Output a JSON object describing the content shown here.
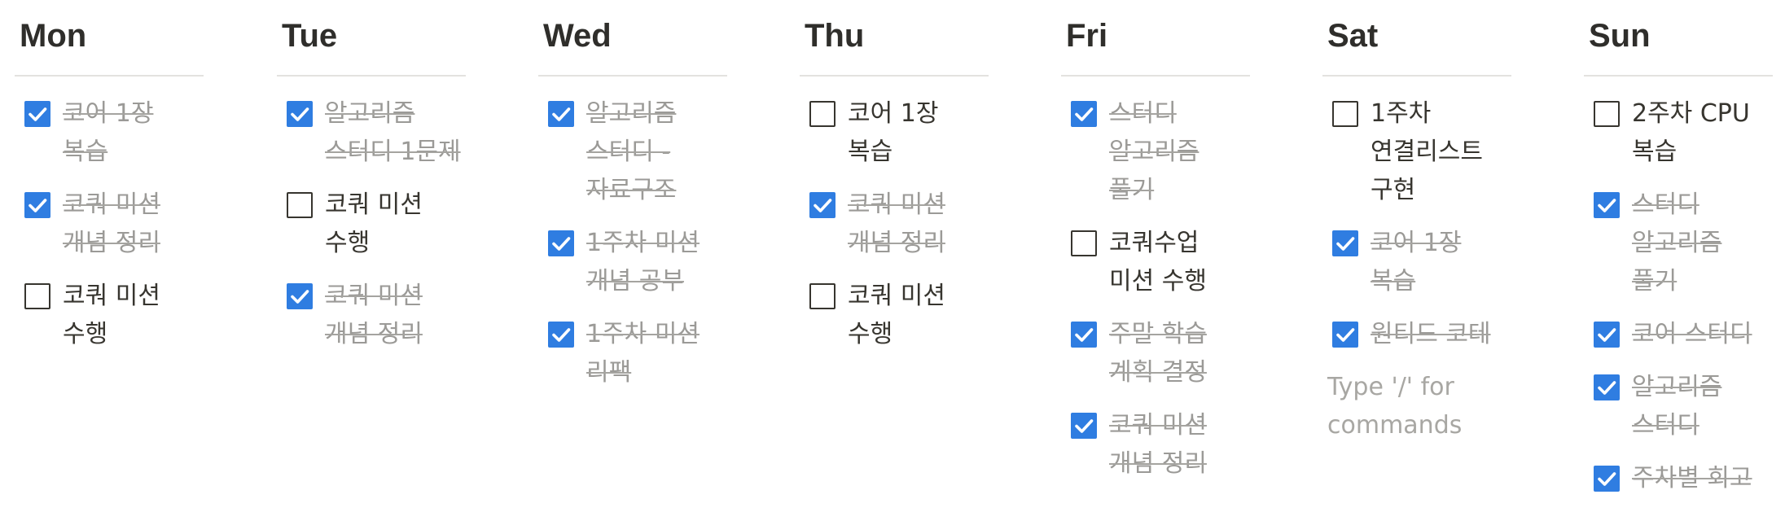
{
  "board": {
    "placeholder": "Type '/' for commands",
    "columns": [
      {
        "day": "Mon",
        "items": [
          {
            "text": "코어 1장 복습",
            "checked": true
          },
          {
            "text": "코쿼 미션 개념 정리",
            "checked": true
          },
          {
            "text": "코쿼 미션 수행",
            "checked": false
          }
        ]
      },
      {
        "day": "Tue",
        "items": [
          {
            "text": "알고리즘 스터디 1문제",
            "checked": true
          },
          {
            "text": "코쿼 미션 수행",
            "checked": false
          },
          {
            "text": "코쿼 미션 개념 정리",
            "checked": true
          }
        ]
      },
      {
        "day": "Wed",
        "items": [
          {
            "text": "알고리즘 스터디 - 자료구조",
            "checked": true
          },
          {
            "text": "1주차 미션 개념 공부",
            "checked": true
          },
          {
            "text": "1주차 미션 리팩",
            "checked": true
          }
        ]
      },
      {
        "day": "Thu",
        "items": [
          {
            "text": "코어 1장 복습",
            "checked": false
          },
          {
            "text": "코쿼 미션 개념 정리",
            "checked": true
          },
          {
            "text": "코쿼 미션 수행",
            "checked": false
          }
        ]
      },
      {
        "day": "Fri",
        "items": [
          {
            "text": "스터디 알고리즘 풀기",
            "checked": true
          },
          {
            "text": "코쿼수업 미션 수행",
            "checked": false
          },
          {
            "text": "주말 학습 계획 결정",
            "checked": true
          },
          {
            "text": "코쿼 미션 개념 정리",
            "checked": true
          }
        ]
      },
      {
        "day": "Sat",
        "items": [
          {
            "text": "1주차 연결리스트 구현",
            "checked": false
          },
          {
            "text": "코어 1장 복습",
            "checked": true
          },
          {
            "text": "원티드 코테",
            "checked": true
          }
        ],
        "has_placeholder": true
      },
      {
        "day": "Sun",
        "items": [
          {
            "text": "2주차 CPU 복습",
            "checked": false
          },
          {
            "text": "스터디 알고리즘 풀기",
            "checked": true
          },
          {
            "text": "코어 스터디",
            "checked": true
          },
          {
            "text": "알고리즘 스터디",
            "checked": true
          },
          {
            "text": "주차별 회고",
            "checked": true
          }
        ]
      }
    ]
  },
  "colors": {
    "checkbox_checked": "#2f7de1",
    "done_text": "#9b9a97",
    "text": "#37352f",
    "divider": "#e3e2df"
  },
  "icons": {
    "checked": "checkmark-icon"
  }
}
